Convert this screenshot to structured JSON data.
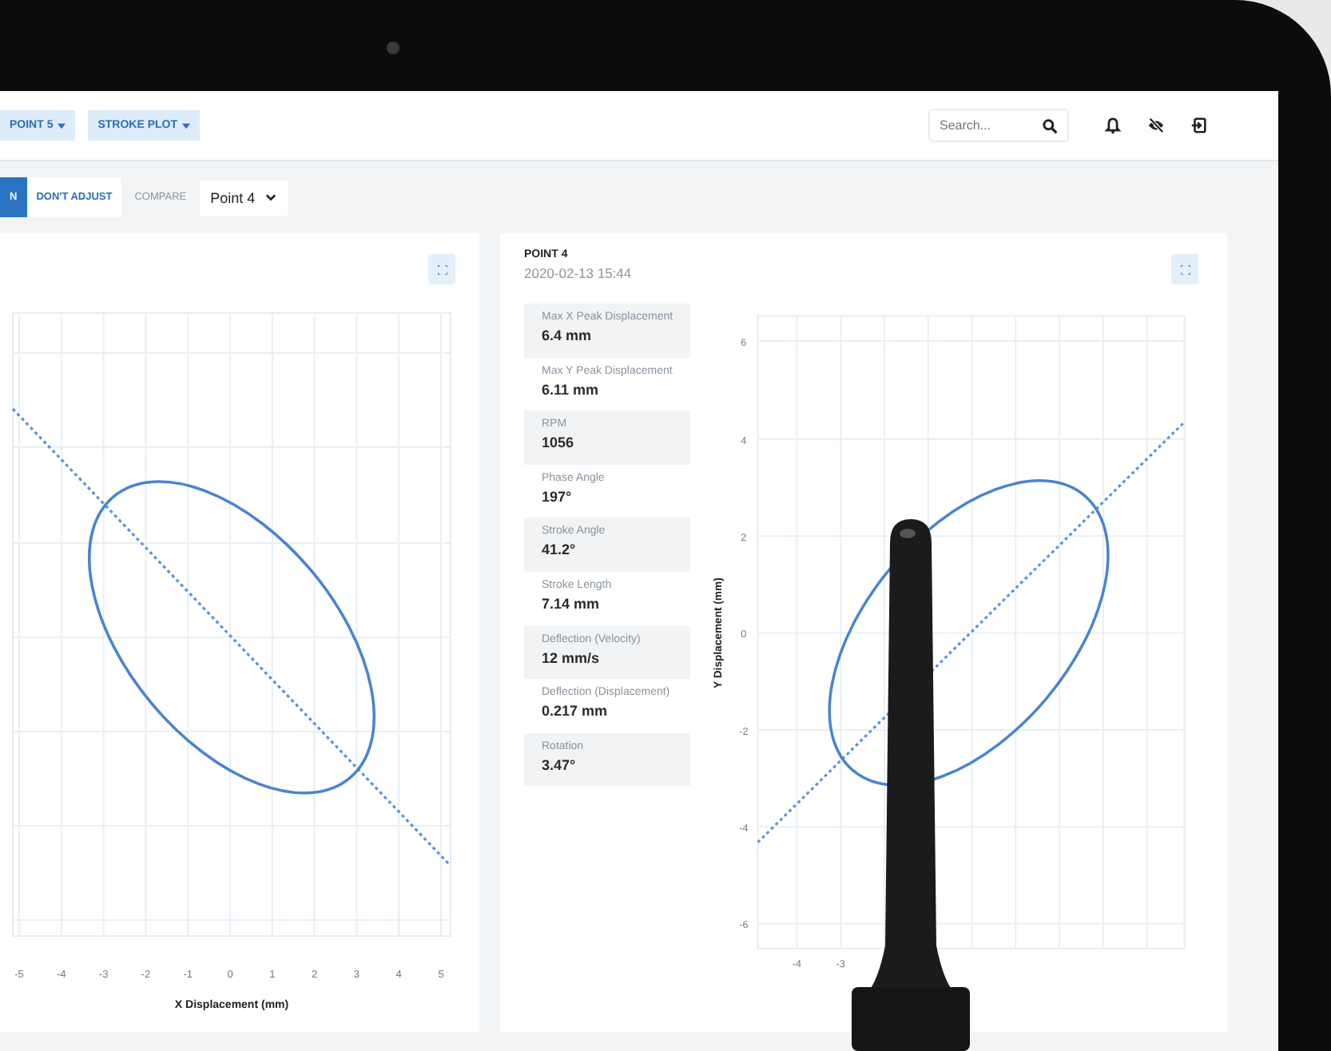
{
  "top_bar": {
    "menus": [
      {
        "label": "POINT 5"
      },
      {
        "label": "STROKE PLOT"
      }
    ],
    "search": {
      "placeholder": "Search..."
    }
  },
  "toolbar": {
    "buttons": [
      {
        "label": "N",
        "selected": true
      },
      {
        "label": "DON'T ADJUST",
        "selected": false
      }
    ],
    "compare_label": "COMPARE",
    "compare_value": "Point 4"
  },
  "left_chart": {
    "x_ticks": [
      "-5",
      "-4",
      "-3",
      "-2",
      "-1",
      "0",
      "1",
      "2",
      "3",
      "4",
      "5"
    ],
    "xlabel": "X Displacement (mm)"
  },
  "right_panel": {
    "title": "POINT 4",
    "timestamp": "2020-02-13 15:44",
    "stats": [
      {
        "label": "Max X Peak Displacement",
        "value": "6.4 mm"
      },
      {
        "label": "Max Y Peak Displacement",
        "value": "6.11 mm"
      },
      {
        "label": "RPM",
        "value": "1056"
      },
      {
        "label": "Phase Angle",
        "value": "197°"
      },
      {
        "label": "Stroke Angle",
        "value": "41.2°"
      },
      {
        "label": "Stroke Length",
        "value": "7.14 mm"
      },
      {
        "label": "Deflection (Velocity)",
        "value": "12 mm/s"
      },
      {
        "label": "Deflection (Displacement)",
        "value": "0.217 mm"
      },
      {
        "label": "Rotation",
        "value": "3.47°"
      }
    ],
    "chart": {
      "y_ticks": [
        "6",
        "4",
        "2",
        "0",
        "-2",
        "-4",
        "-6"
      ],
      "ylabel": "Y Displacement (mm)",
      "x_ticks": [
        "-4",
        "-3"
      ]
    }
  }
}
